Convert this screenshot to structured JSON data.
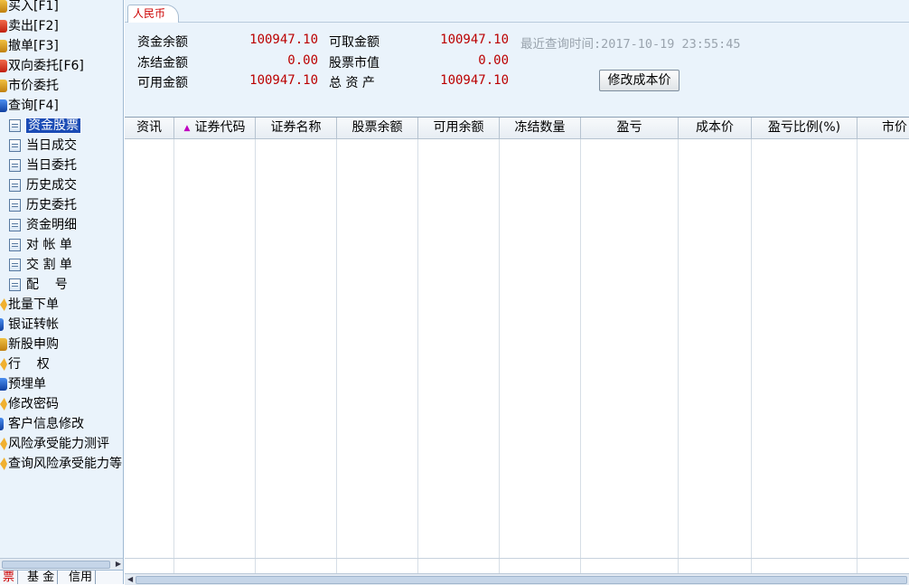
{
  "sidebar": {
    "items": [
      {
        "label": "买入[F1]",
        "icon": "buy-icon",
        "color": "#d9a020"
      },
      {
        "label": "卖出[F2]",
        "icon": "sell-icon",
        "color": "#d04020"
      },
      {
        "label": "撤单[F3]",
        "icon": "cancel-order-icon",
        "color": "#d9a020"
      },
      {
        "label": "双向委托[F6]",
        "icon": "dual-order-icon",
        "color": "#d04020"
      },
      {
        "label": "市价委托",
        "icon": "market-order-icon",
        "color": "#d9a020"
      },
      {
        "label": "查询[F4]",
        "icon": "query-icon",
        "color": "#2a70d8"
      }
    ],
    "query_children": [
      {
        "label": "资金股票",
        "selected": true
      },
      {
        "label": "当日成交"
      },
      {
        "label": "当日委托"
      },
      {
        "label": "历史成交"
      },
      {
        "label": "历史委托"
      },
      {
        "label": "资金明细"
      },
      {
        "label": "对 帐 单"
      },
      {
        "label": "交 割 单"
      },
      {
        "label": "配    号"
      }
    ],
    "items_after": [
      {
        "label": "批量下单",
        "icon": "batch-order-icon"
      },
      {
        "label": "银证转帐",
        "icon": "bank-transfer-icon"
      },
      {
        "label": "新股申购",
        "icon": "ipo-subscribe-icon"
      },
      {
        "label": "行    权",
        "icon": "exercise-icon"
      },
      {
        "label": "预埋单",
        "icon": "preset-order-icon"
      },
      {
        "label": "修改密码",
        "icon": "change-password-icon"
      },
      {
        "label": "客户信息修改",
        "icon": "customer-info-icon"
      },
      {
        "label": "风险承受能力测评",
        "icon": "risk-assessment-icon"
      },
      {
        "label": "查询风险承受能力等",
        "icon": "risk-query-icon"
      }
    ],
    "bottom_tabs": [
      "票",
      "基 金",
      "信用"
    ]
  },
  "currency_tab": "人民币",
  "funds": {
    "balance_label": "资金余额",
    "balance": "100947.10",
    "frozen_label": "冻结金额",
    "frozen": "0.00",
    "available_label": "可用金额",
    "available": "100947.10",
    "withdrawable_label": "可取金额",
    "withdrawable": "100947.10",
    "market_value_label": "股票市值",
    "market_value": "0.00",
    "total_assets_label": "总 资 产",
    "total_assets": "100947.10",
    "last_query": "最近查询时间:2017-10-19 23:55:45",
    "modify_cost_button": "修改成本价"
  },
  "table": {
    "columns": [
      "资讯",
      "证券代码",
      "证券名称",
      "股票余额",
      "可用余额",
      "冻结数量",
      "盈亏",
      "成本价",
      "盈亏比例(%)",
      "市价"
    ],
    "rows": []
  },
  "colors": {
    "value_red": "#b00000",
    "selection": "#1a4bb5",
    "panel_bg": "#eaf3fb"
  }
}
